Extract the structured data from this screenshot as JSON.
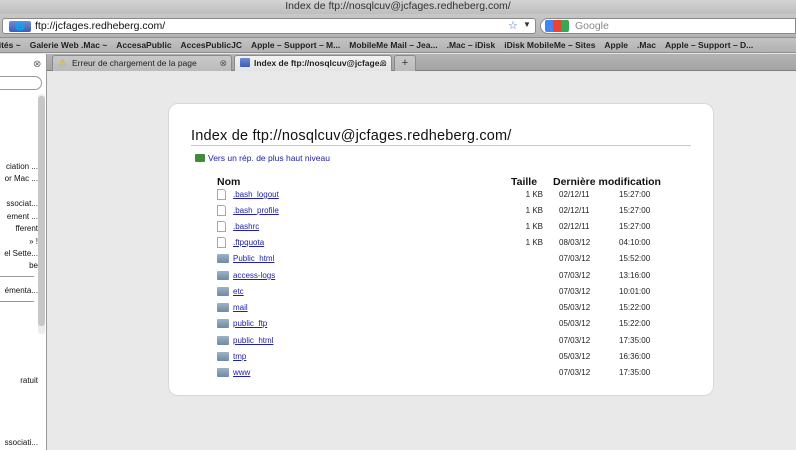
{
  "window": {
    "title": "Index de ftp://nosqlcuv@jcfages.redheberg.com/"
  },
  "toolbar": {
    "site_badge": "🌐",
    "url": "ftp://jcfages.redheberg.com/",
    "search_placeholder": "Google"
  },
  "bookmarks": [
    "sités ~",
    "Galerie Web .Mac ~",
    "AccesaPublic",
    "AccesPublicJC",
    "Apple – Support – M...",
    "MobileMe Mail – Jea...",
    ".Mac – iDisk",
    "iDisk MobileMe – Sites",
    "Apple",
    ".Mac",
    "Apple – Support – D..."
  ],
  "sidebar": {
    "items": [
      "ciation ...",
      "or Mac ...",
      "ssociat...",
      "ement ...",
      "fferent",
      "» !",
      "el Sette...",
      "be",
      "émenta...",
      "ratuit",
      "ssociati..."
    ]
  },
  "tabs": [
    {
      "label": "Erreur de chargement de la page",
      "close": "⊗"
    },
    {
      "label": "Index de ftp://nosqlcuv@jcfage...",
      "close": "⊗"
    }
  ],
  "newtab_label": "+",
  "page": {
    "title": "Index de ftp://nosqlcuv@jcfages.redheberg.com/",
    "up_link": "Vers un rép. de plus haut niveau",
    "headers": {
      "name": "Nom",
      "size": "Taille",
      "modified": "Dernière modification"
    },
    "entries": [
      {
        "type": "file",
        "name": ".bash_logout",
        "size": "1 KB",
        "date": "02/12/11",
        "time": "15:27:00"
      },
      {
        "type": "file",
        "name": ".bash_profile",
        "size": "1 KB",
        "date": "02/12/11",
        "time": "15:27:00"
      },
      {
        "type": "file",
        "name": ".bashrc",
        "size": "1 KB",
        "date": "02/12/11",
        "time": "15:27:00"
      },
      {
        "type": "file",
        "name": ".ftpquota",
        "size": "1 KB",
        "date": "08/03/12",
        "time": "04:10:00"
      },
      {
        "type": "folder",
        "name": "Public_html",
        "size": "",
        "date": "07/03/12",
        "time": "15:52:00"
      },
      {
        "type": "folder",
        "name": "access-logs",
        "size": "",
        "date": "07/03/12",
        "time": "13:16:00"
      },
      {
        "type": "folder",
        "name": "etc",
        "size": "",
        "date": "07/03/12",
        "time": "10:01:00"
      },
      {
        "type": "folder",
        "name": "mail",
        "size": "",
        "date": "05/03/12",
        "time": "15:22:00"
      },
      {
        "type": "folder",
        "name": "public_ftp",
        "size": "",
        "date": "05/03/12",
        "time": "15:22:00"
      },
      {
        "type": "folder",
        "name": "public_html",
        "size": "",
        "date": "07/03/12",
        "time": "17:35:00"
      },
      {
        "type": "folder",
        "name": "tmp",
        "size": "",
        "date": "05/03/12",
        "time": "16:36:00"
      },
      {
        "type": "folder",
        "name": "www",
        "size": "",
        "date": "07/03/12",
        "time": "17:35:00"
      }
    ]
  }
}
